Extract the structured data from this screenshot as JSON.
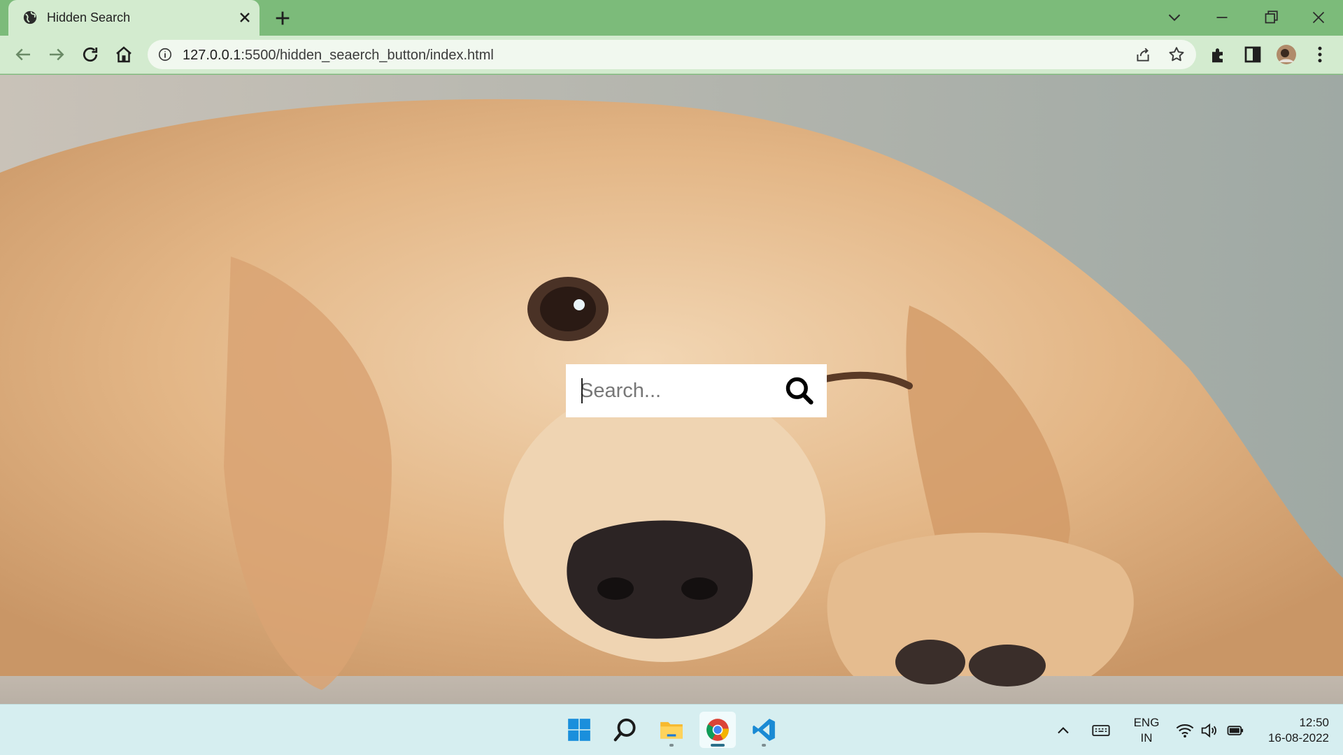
{
  "browser": {
    "tab": {
      "title": "Hidden Search"
    },
    "address": {
      "host": "127.0.0.1",
      "rest": ":5500/hidden_seaerch_button/index.html"
    }
  },
  "page": {
    "search": {
      "placeholder": "Search...",
      "value": ""
    }
  },
  "taskbar": {
    "apps": [
      "windows-start",
      "search",
      "file-explorer",
      "chrome",
      "vscode"
    ],
    "language": {
      "line1": "ENG",
      "line2": "IN"
    },
    "clock": {
      "time": "12:50",
      "date": "16-08-2022"
    }
  },
  "colors": {
    "tab_strip": "#7cbb7a",
    "toolbar": "#d3ebcf",
    "taskbar": "#d6eef0",
    "search_bg": "#ffffff"
  }
}
